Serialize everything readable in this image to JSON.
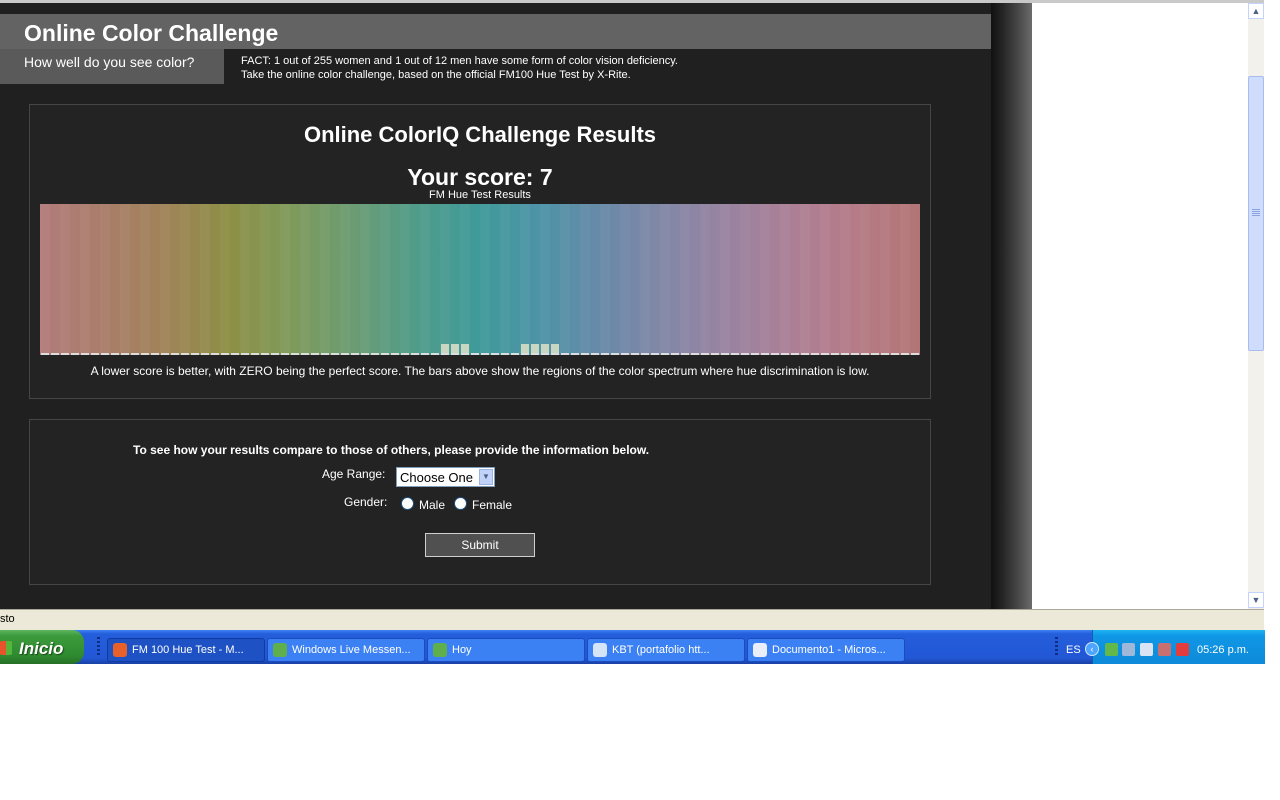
{
  "site": {
    "title": "Online Color Challenge",
    "tagline": "How well do you see color?",
    "fact_line1": "FACT: 1 out of 255 women and 1 out of 12 men have some form of color vision deficiency.",
    "fact_line2": "Take the online color challenge, based on the official FM100 Hue Test by X-Rite."
  },
  "results": {
    "title": "Online ColorIQ Challenge Results",
    "score_text": "Your score: 7",
    "note": "A lower score is better, with ZERO being the perfect score. The bars above show the regions of the color spectrum where hue discrimination is low."
  },
  "chart_data": {
    "type": "bar",
    "title": "FM Hue Test Results",
    "description_hint": null,
    "num_caps": 88,
    "error_bars": [
      {
        "cap": 40,
        "value": 1
      },
      {
        "cap": 41,
        "value": 1
      },
      {
        "cap": 42,
        "value": 1
      },
      {
        "cap": 48,
        "value": 1
      },
      {
        "cap": 49,
        "value": 1
      },
      {
        "cap": 50,
        "value": 1
      },
      {
        "cap": 51,
        "value": 1
      }
    ],
    "spectrum_stops": [
      "#b27b7b",
      "#a97d6a",
      "#a08358",
      "#8d8f45",
      "#7f9a5b",
      "#6b9c73",
      "#4f9c8a",
      "#3f9a9a",
      "#4e93a7",
      "#6a89a8",
      "#8487a6",
      "#9a83a0",
      "#ad7f95",
      "#b57b86",
      "#b27575"
    ],
    "baseline_color": "#dddddd",
    "bar_color": "#c8d6c2"
  },
  "form": {
    "intro": "To see how your results compare to those of others, please provide the information below.",
    "age_label": "Age Range:",
    "age_value": "Choose One",
    "gender_label": "Gender:",
    "male_label": "Male",
    "female_label": "Female",
    "submit_label": "Submit"
  },
  "status_bar": {
    "text": "sto"
  },
  "taskbar": {
    "start_label": "Inicio",
    "tasks": [
      {
        "label": "FM 100 Hue Test - M...",
        "icon_color": "#e8612b",
        "active": true
      },
      {
        "label": "Windows Live Messen...",
        "icon_color": "#5fb04c",
        "active": false
      },
      {
        "label": "Hoy",
        "icon_color": "#5fb04c",
        "active": false
      },
      {
        "label": "KBT (portafolio     htt...",
        "icon_color": "#d6e4f7",
        "active": false
      },
      {
        "label": "Documento1 - Micros...",
        "icon_color": "#e9eef9",
        "active": false
      }
    ],
    "language": "ES",
    "clock": "05:26 p.m.",
    "tray_icons": [
      "network-icon",
      "security-icon",
      "volume-icon",
      "speaker-icon",
      "antivirus-icon"
    ]
  }
}
